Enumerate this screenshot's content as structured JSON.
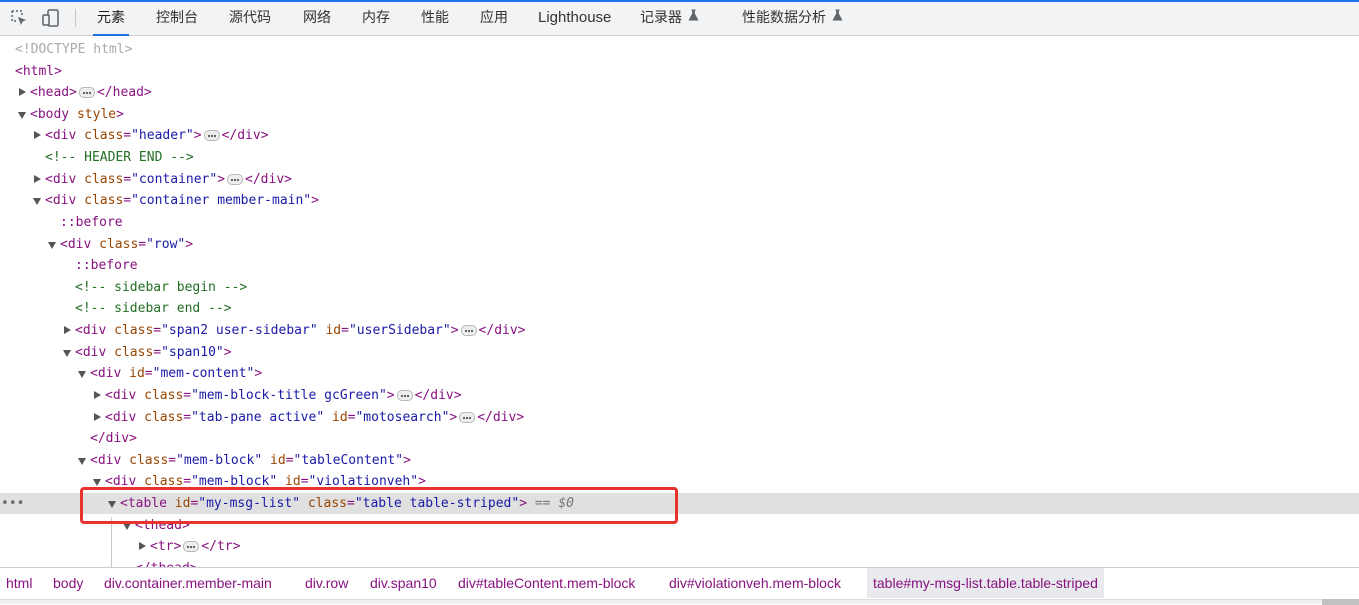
{
  "toolbar": {
    "tabs": [
      {
        "label": "元素",
        "active": true
      },
      {
        "label": "控制台"
      },
      {
        "label": "源代码"
      },
      {
        "label": "网络"
      },
      {
        "label": "内存"
      },
      {
        "label": "性能"
      },
      {
        "label": "应用"
      },
      {
        "label": "Lighthouse"
      },
      {
        "label": "记录器",
        "icon": "flask-icon"
      },
      {
        "label": "性能数据分析",
        "icon": "flask-icon"
      }
    ],
    "accent_color": "#1a73e8"
  },
  "dom_tree": {
    "lines": [
      {
        "doctype": "<!DOCTYPE html>"
      },
      {
        "open": "<html>"
      },
      {
        "tag_open": "<head>",
        "tag_close": "</head>"
      },
      {
        "tag": "<body",
        "attr": " style",
        "end": ">"
      },
      {
        "tag": "<div",
        "a1": " class",
        "v1": "\"header\"",
        "end": ">",
        "close": "</div>"
      },
      {
        "comment": "<!-- HEADER END -->"
      },
      {
        "tag": "<div",
        "a1": " class",
        "v1": "\"container\"",
        "end": ">",
        "close": "</div>"
      },
      {
        "tag": "<div",
        "a1": " class",
        "v1": "\"container member-main\"",
        "end": ">"
      },
      {
        "pseudo": "::before"
      },
      {
        "tag": "<div",
        "a1": " class",
        "v1": "\"row\"",
        "end": ">"
      },
      {
        "pseudo": "::before"
      },
      {
        "comment": "<!-- sidebar begin -->"
      },
      {
        "comment": "<!-- sidebar end -->"
      },
      {
        "tag": "<div",
        "a1": " class",
        "v1": "\"span2 user-sidebar\"",
        "a2": " id",
        "v2": "\"userSidebar\"",
        "end": ">",
        "close": "</div>"
      },
      {
        "tag": "<div",
        "a1": " class",
        "v1": "\"span10\"",
        "end": ">"
      },
      {
        "tag": "<div",
        "a1": " id",
        "v1": "\"mem-content\"",
        "end": ">"
      },
      {
        "tag": "<div",
        "a1": " class",
        "v1": "\"mem-block-title gcGreen\"",
        "end": ">",
        "close": "</div>"
      },
      {
        "tag": "<div",
        "a1": " class",
        "v1": "\"tab-pane active\"",
        "a2": " id",
        "v2": "\"motosearch\"",
        "end": ">",
        "close": "</div>"
      },
      {
        "close_only": "</div>"
      },
      {
        "tag": "<div",
        "a1": " class",
        "v1": "\"mem-block\"",
        "a2": " id",
        "v2": "\"tableContent\"",
        "end": ">"
      },
      {
        "tag": "<div",
        "a1": " class",
        "v1": "\"mem-block\"",
        "a2": " id",
        "v2": "\"violationveh\"",
        "end": ">"
      },
      {
        "tag": "<table",
        "a1": " id",
        "v1": "\"my-msg-list\"",
        "a2": " class",
        "v2": "\"table table-striped\"",
        "end": ">",
        "eq": " == ",
        "var": "$0"
      },
      {
        "open": "<thead>"
      },
      {
        "tag_open": "<tr>",
        "tag_close": "</tr>"
      },
      {
        "close_only": "</thead>"
      }
    ],
    "row_dots": "•••"
  },
  "breadcrumbs": [
    {
      "label": "html"
    },
    {
      "label": "body"
    },
    {
      "label": "div.container.member-main"
    },
    {
      "label": "div.row"
    },
    {
      "label": "div.span10"
    },
    {
      "label": "div#tableContent.mem-block"
    },
    {
      "label": "div#violationveh.mem-block"
    },
    {
      "label": "table#my-msg-list.table.table-striped",
      "active": true
    }
  ]
}
